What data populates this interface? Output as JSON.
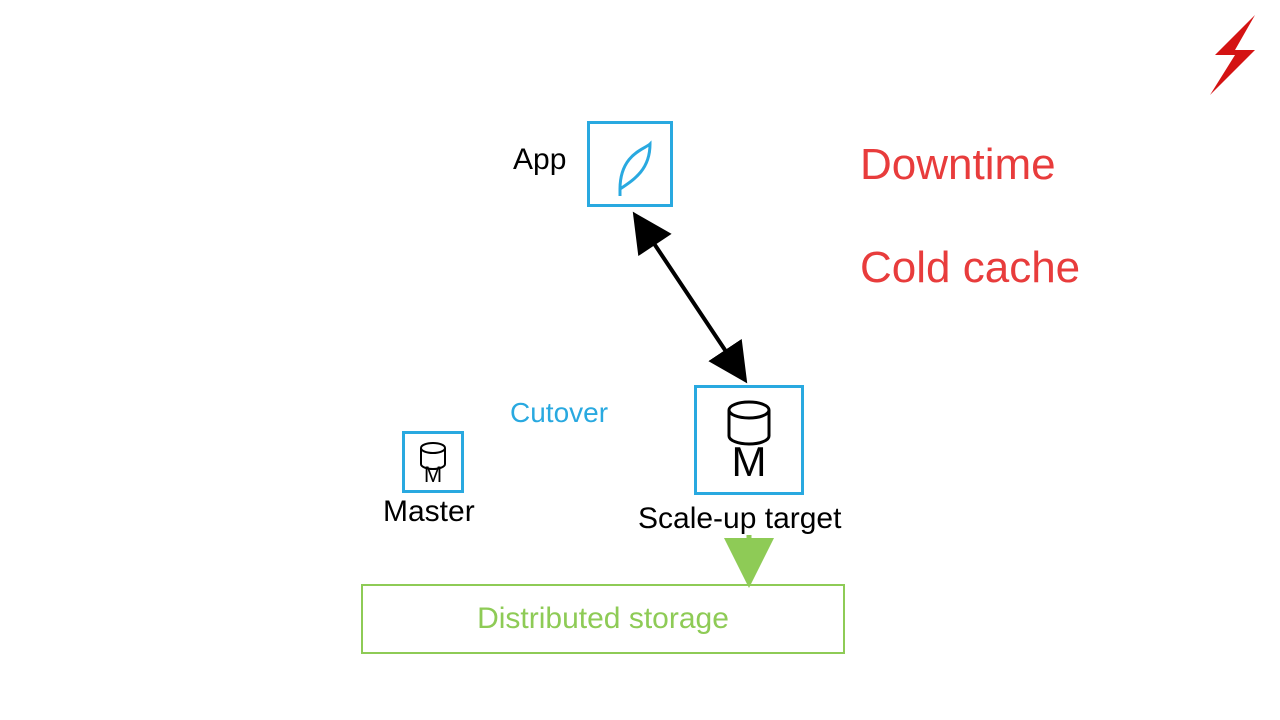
{
  "labels": {
    "app": "App",
    "cutover": "Cutover",
    "master": "Master",
    "scaleup": "Scale-up target",
    "downtime": "Downtime",
    "coldcache": "Cold cache",
    "storage": "Distributed storage",
    "m_small": "M",
    "m_large": "M"
  },
  "colors": {
    "cyan": "#29a9e0",
    "red": "#e83c3c",
    "green": "#8ecb56",
    "black": "#000000",
    "bolt": "#d41313"
  }
}
